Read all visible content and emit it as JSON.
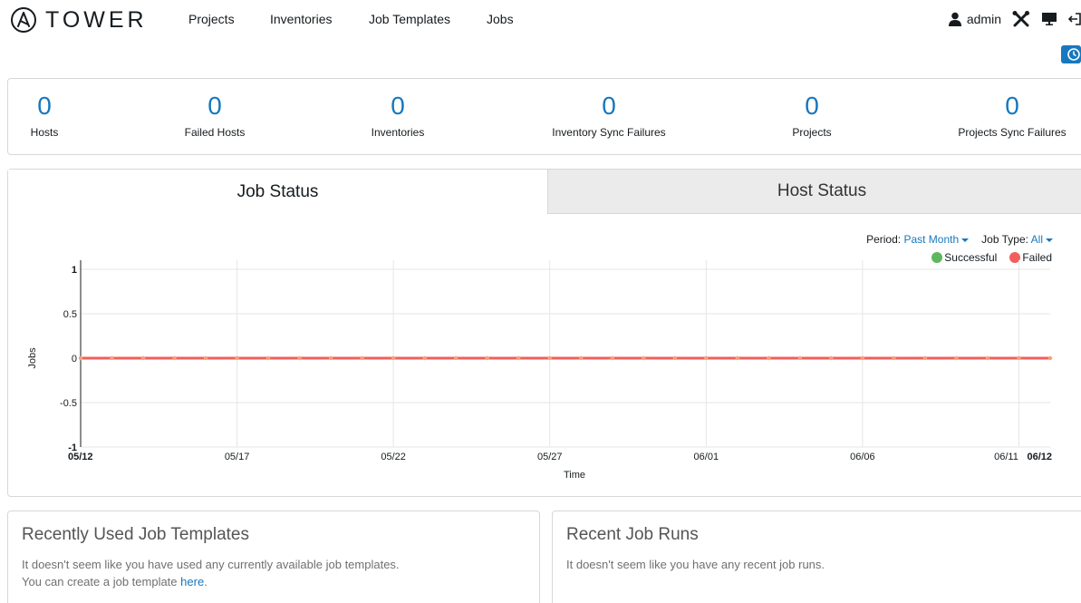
{
  "brand": {
    "name": "TOWER"
  },
  "nav": {
    "links": [
      "Projects",
      "Inventories",
      "Job Templates",
      "Jobs"
    ],
    "user": "admin"
  },
  "icons": {
    "logo": "ansible-logo-icon",
    "user": "user-icon",
    "setup": "wrench-screwdriver-icon",
    "monitor": "monitor-icon",
    "logout": "logout-icon",
    "activity": "clock-icon"
  },
  "counts": [
    {
      "value": "0",
      "label": "Hosts"
    },
    {
      "value": "0",
      "label": "Failed Hosts"
    },
    {
      "value": "0",
      "label": "Inventories"
    },
    {
      "value": "0",
      "label": "Inventory Sync Failures"
    },
    {
      "value": "0",
      "label": "Projects"
    },
    {
      "value": "0",
      "label": "Projects Sync Failures"
    }
  ],
  "tabs": {
    "job_status": "Job Status",
    "host_status": "Host Status"
  },
  "filters": {
    "period_label": "Period:",
    "period_value": "Past Month",
    "type_label": "Job Type:",
    "type_value": "All"
  },
  "colors": {
    "accent": "#1778be",
    "successful": "#5cb85c",
    "failed": "#f25e5e"
  },
  "chart_data": {
    "type": "line",
    "xlabel": "Time",
    "ylabel": "Jobs",
    "ylim": [
      -1,
      1
    ],
    "yticks": [
      "1",
      "0.5",
      "0",
      "-0.5",
      "-1"
    ],
    "xticks": [
      "05/12",
      "05/17",
      "05/22",
      "05/27",
      "06/01",
      "06/06",
      "06/11",
      "06/12"
    ],
    "grid": true,
    "legend_position": "top-right",
    "series": [
      {
        "name": "Successful",
        "values": [
          0,
          0,
          0,
          0,
          0,
          0,
          0,
          0,
          0,
          0,
          0,
          0,
          0,
          0,
          0,
          0,
          0,
          0,
          0,
          0,
          0,
          0,
          0,
          0,
          0,
          0,
          0,
          0,
          0,
          0,
          0,
          0
        ]
      },
      {
        "name": "Failed",
        "values": [
          0,
          0,
          0,
          0,
          0,
          0,
          0,
          0,
          0,
          0,
          0,
          0,
          0,
          0,
          0,
          0,
          0,
          0,
          0,
          0,
          0,
          0,
          0,
          0,
          0,
          0,
          0,
          0,
          0,
          0,
          0,
          0
        ]
      }
    ]
  },
  "recent_templates": {
    "title": "Recently Used Job Templates",
    "text1": "It doesn't seem like you have used any currently available job templates.",
    "text2": "You can create a job template",
    "link": "here",
    "text3": "."
  },
  "recent_runs": {
    "title": "Recent Job Runs",
    "text": "It doesn't seem like you have any recent job runs."
  }
}
